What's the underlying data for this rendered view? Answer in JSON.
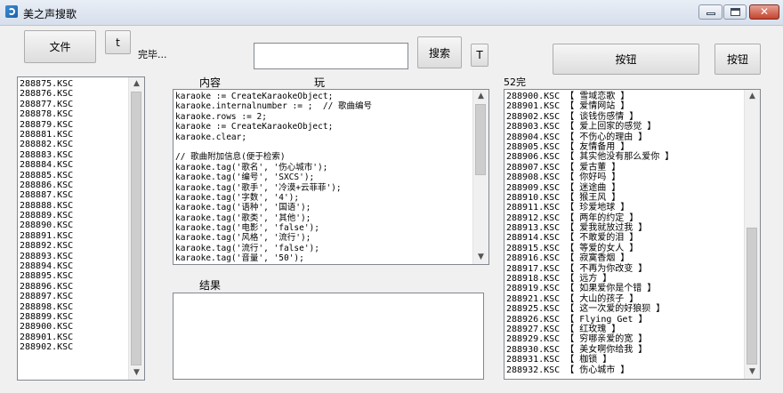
{
  "window": {
    "title": "美之声搜歌"
  },
  "toolbar": {
    "file_button": "文件",
    "t_button_1": "t",
    "status": "完毕...",
    "search_value": "",
    "search_button": "搜索",
    "t_button_2": "T",
    "button_1": "按钮",
    "button_2": "按钮"
  },
  "labels": {
    "content": "内容",
    "play": "玩",
    "result": "结果",
    "count": "52完"
  },
  "left_list": {
    "items": [
      "288875.KSC",
      "288876.KSC",
      "288877.KSC",
      "288878.KSC",
      "288879.KSC",
      "288881.KSC",
      "288882.KSC",
      "288883.KSC",
      "288884.KSC",
      "288885.KSC",
      "288886.KSC",
      "288887.KSC",
      "288888.KSC",
      "288889.KSC",
      "288890.KSC",
      "288891.KSC",
      "288892.KSC",
      "288893.KSC",
      "288894.KSC",
      "288895.KSC",
      "288896.KSC",
      "288897.KSC",
      "288898.KSC",
      "288899.KSC",
      "288900.KSC",
      "288901.KSC",
      "288902.KSC"
    ]
  },
  "content_box": {
    "lines": [
      "karaoke := CreateKaraokeObject;",
      "karaoke.internalnumber := ;  // 歌曲编号",
      "karaoke.rows := 2;",
      "karaoke := CreateKaraokeObject;",
      "karaoke.clear;",
      "",
      "// 歌曲附加信息(便于检索)",
      "karaoke.tag('歌名', '伤心城市');",
      "karaoke.tag('编号', 'SXCS');",
      "karaoke.tag('歌手', '冷漠+云菲菲');",
      "karaoke.tag('字数', '4');",
      "karaoke.tag('语种', '国语');",
      "karaoke.tag('歌类', '其他');",
      "karaoke.tag('电影', 'false');",
      "karaoke.tag('风格', '流行');",
      "karaoke.tag('流行', 'false');",
      "karaoke.tag('音量', '50');"
    ]
  },
  "result_box": {
    "value": ""
  },
  "right_list": {
    "items": [
      "288900.KSC 【 雪域恋歌 】",
      "288901.KSC 【 爱情网站 】",
      "288902.KSC 【 谈钱伤感情 】",
      "288903.KSC 【 爱上回家的感觉 】",
      "288904.KSC 【 不伤心的理由 】",
      "288905.KSC 【 友情备用 】",
      "288906.KSC 【 其实他没有那么爱你 】",
      "288907.KSC 【 爱古董 】",
      "288908.KSC 【 你好吗 】",
      "288909.KSC 【 迷途曲 】",
      "288910.KSC 【 猴王风 】",
      "288911.KSC 【 珍爱地球 】",
      "288912.KSC 【 两年的约定 】",
      "288913.KSC 【 爱我就放过我 】",
      "288914.KSC 【 不敢爱的泪 】",
      "288915.KSC 【 等爱的女人 】",
      "288916.KSC 【 寂寞香烟 】",
      "288917.KSC 【 不再为你改变 】",
      "288918.KSC 【 远方 】",
      "288919.KSC 【 如果爱你是个错 】",
      "288921.KSC 【 大山的孩子 】",
      "288925.KSC 【 这一次爱的好狼狈 】",
      "288926.KSC 【 Flying Get 】",
      "288927.KSC 【 红玫瑰 】",
      "288929.KSC 【 穷哪亲爱的宽 】",
      "288930.KSC 【 美女啊你给我 】",
      "288931.KSC 【 枷锁 】",
      "288932.KSC 【 伤心城市 】"
    ]
  }
}
